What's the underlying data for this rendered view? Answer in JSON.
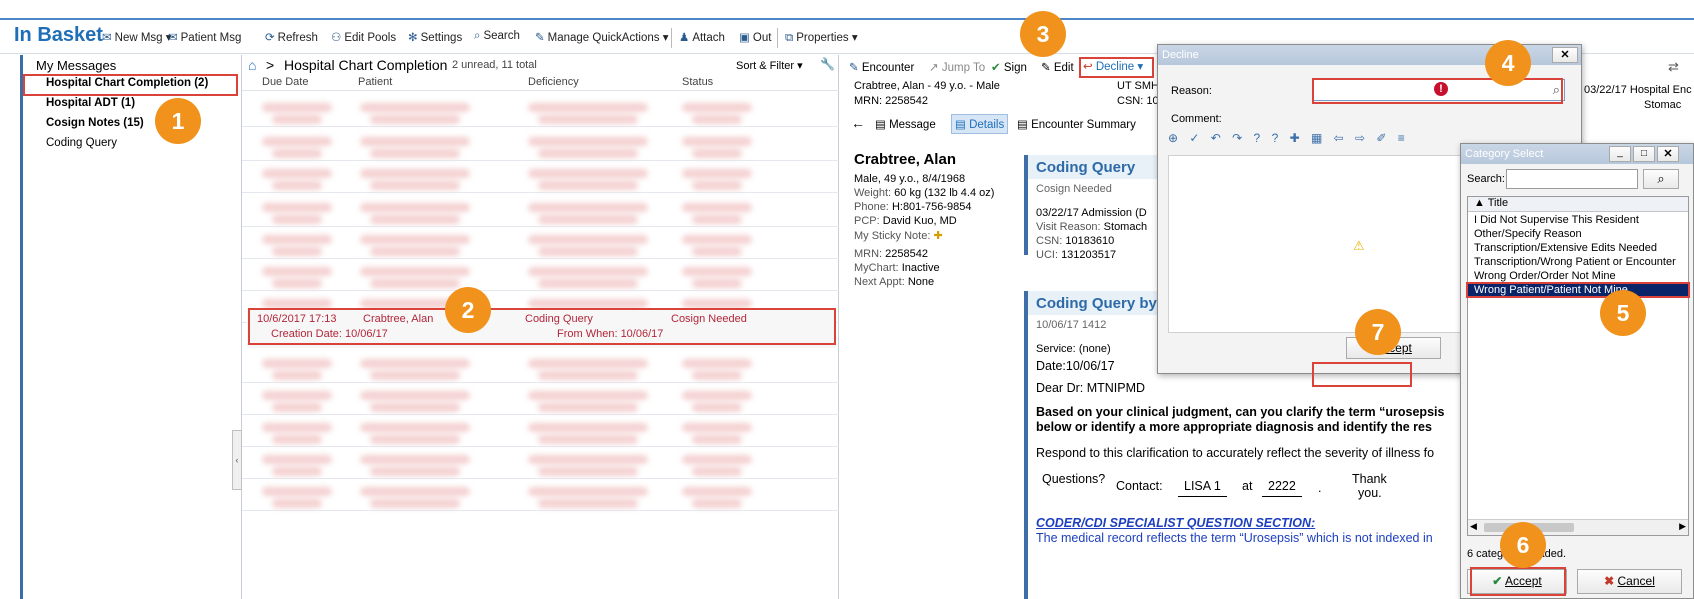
{
  "app": {
    "title": "In Basket"
  },
  "toolbar": {
    "items": [
      {
        "icon": "new-msg-icon",
        "label": "New Msg ▾"
      },
      {
        "icon": "patient-msg-icon",
        "label": "Patient Msg"
      },
      {
        "icon": "refresh-icon",
        "label": "Refresh"
      },
      {
        "icon": "pools-icon",
        "label": "Edit Pools"
      },
      {
        "icon": "settings-icon",
        "label": "Settings"
      },
      {
        "icon": "search-icon",
        "label": "Search"
      },
      {
        "icon": "pencil-icon",
        "label": "Manage QuickActions ▾"
      },
      {
        "icon": "attach-icon",
        "label": "Attach"
      },
      {
        "icon": "out-icon",
        "label": "Out"
      },
      {
        "icon": "properties-icon",
        "label": "Properties ▾"
      }
    ]
  },
  "left": {
    "header": "My Messages",
    "folders": [
      {
        "label": "Hospital Chart Completion (2)",
        "bold": true
      },
      {
        "label": "Hospital ADT (1)",
        "bold": true
      },
      {
        "label": "Cosign Notes (15)",
        "bold": true
      },
      {
        "label": "Coding Query",
        "bold": false
      }
    ]
  },
  "list": {
    "breadcrumb": "Hospital Chart Completion",
    "summary": "2 unread, 11 total",
    "sort_filter": "Sort & Filter ▾",
    "columns": [
      "Due Date",
      "Patient",
      "Deficiency",
      "Status"
    ],
    "selected": {
      "due": "10/6/2017 17:13",
      "patient": "Crabtree, Alan",
      "deficiency": "Coding Query",
      "status": "Cosign Needed",
      "creation": "Creation Date: 10/06/17",
      "from_when": "From When: 10/06/17"
    }
  },
  "detail": {
    "toolbar": [
      "Encounter",
      "Jump To",
      "Sign",
      "Edit",
      "Decline ▾"
    ],
    "patient_line1": "Crabtree, Alan - 49 y.o. - Male",
    "patient_line2": "MRN: 2258542",
    "facility": "UT SMH",
    "csn_short": "CSN: 10",
    "tabs": [
      "Message",
      "Details",
      "Encounter Summary"
    ],
    "name": "Crabtree, Alan",
    "demographics": [
      {
        "label": "",
        "value": "Male, 49 y.o., 8/4/1968"
      },
      {
        "label": "Weight:",
        "value": "60 kg (132 lb 4.4 oz)"
      },
      {
        "label": "Phone:",
        "value": "H:801-756-9854"
      },
      {
        "label": "PCP:",
        "value": "David Kuo, MD"
      },
      {
        "label": "My Sticky Note:",
        "value": ""
      },
      {
        "label": "MRN:",
        "value": "2258542"
      },
      {
        "label": "MyChart:",
        "value": "Inactive"
      },
      {
        "label": "Next Appt:",
        "value": "None"
      }
    ],
    "card1": {
      "title": "Coding Query",
      "subtitle": "Cosign Needed",
      "admission": "03/22/17 Admission (D",
      "visit_label": "Visit Reason:",
      "visit": "Stomach",
      "csn_label": "CSN:",
      "csn": "10183610",
      "uci_label": "UCI:",
      "uci": "131203517"
    },
    "card2": {
      "title": "Coding Query by",
      "date": "10/06/17 1412",
      "service_label": "Service:",
      "service": "(none)",
      "date_label": "Date:10/06/17",
      "greeting": "Dear Dr: MTNIPMD",
      "bold1": "Based on your clinical judgment, can you clarify the term “urosepsis",
      "bold2": "below or identify a more appropriate diagnosis and identify the res",
      "respond": "Respond to this clarification to accurately reflect the severity of illness fo",
      "questions": "Questions?",
      "contact": "Contact:",
      "contact_name": "LISA 1",
      "at": "at",
      "ext": "2222",
      "thank1": "Thank",
      "thank2": "you.",
      "coder_heading": "CODER/CDI SPECIALIST QUESTION SECTION:",
      "coder_text": "The medical record reflects the term “Urosepsis” which is not indexed in"
    },
    "right_header": "03/22/17 Hospital Enc",
    "right_sub": "Stomac"
  },
  "decline": {
    "title": "Decline",
    "close": "✕",
    "reason_label": "Reason:",
    "comment_label": "Comment:",
    "accept": "Accept"
  },
  "category": {
    "title": "Category Select",
    "search_label": "Search:",
    "col_title": "Title",
    "items": [
      "I Did Not Supervise This Resident",
      "Other/Specify Reason",
      "Transcription/Extensive Edits Needed",
      "Transcription/Wrong Patient or Encounter",
      "Wrong Order/Order Not Mine",
      "Wrong Patient/Patient Not Mine"
    ],
    "selected_index": 5,
    "status": "6 categories loaded.",
    "accept": "Accept",
    "cancel": "Cancel"
  },
  "callouts": [
    "1",
    "2",
    "3",
    "4",
    "5",
    "6",
    "7"
  ],
  "colors": {
    "accent": "#1e6fb8",
    "callout": "#f0921b",
    "highlight_border": "#d9433a",
    "selected": "#0a246a"
  }
}
